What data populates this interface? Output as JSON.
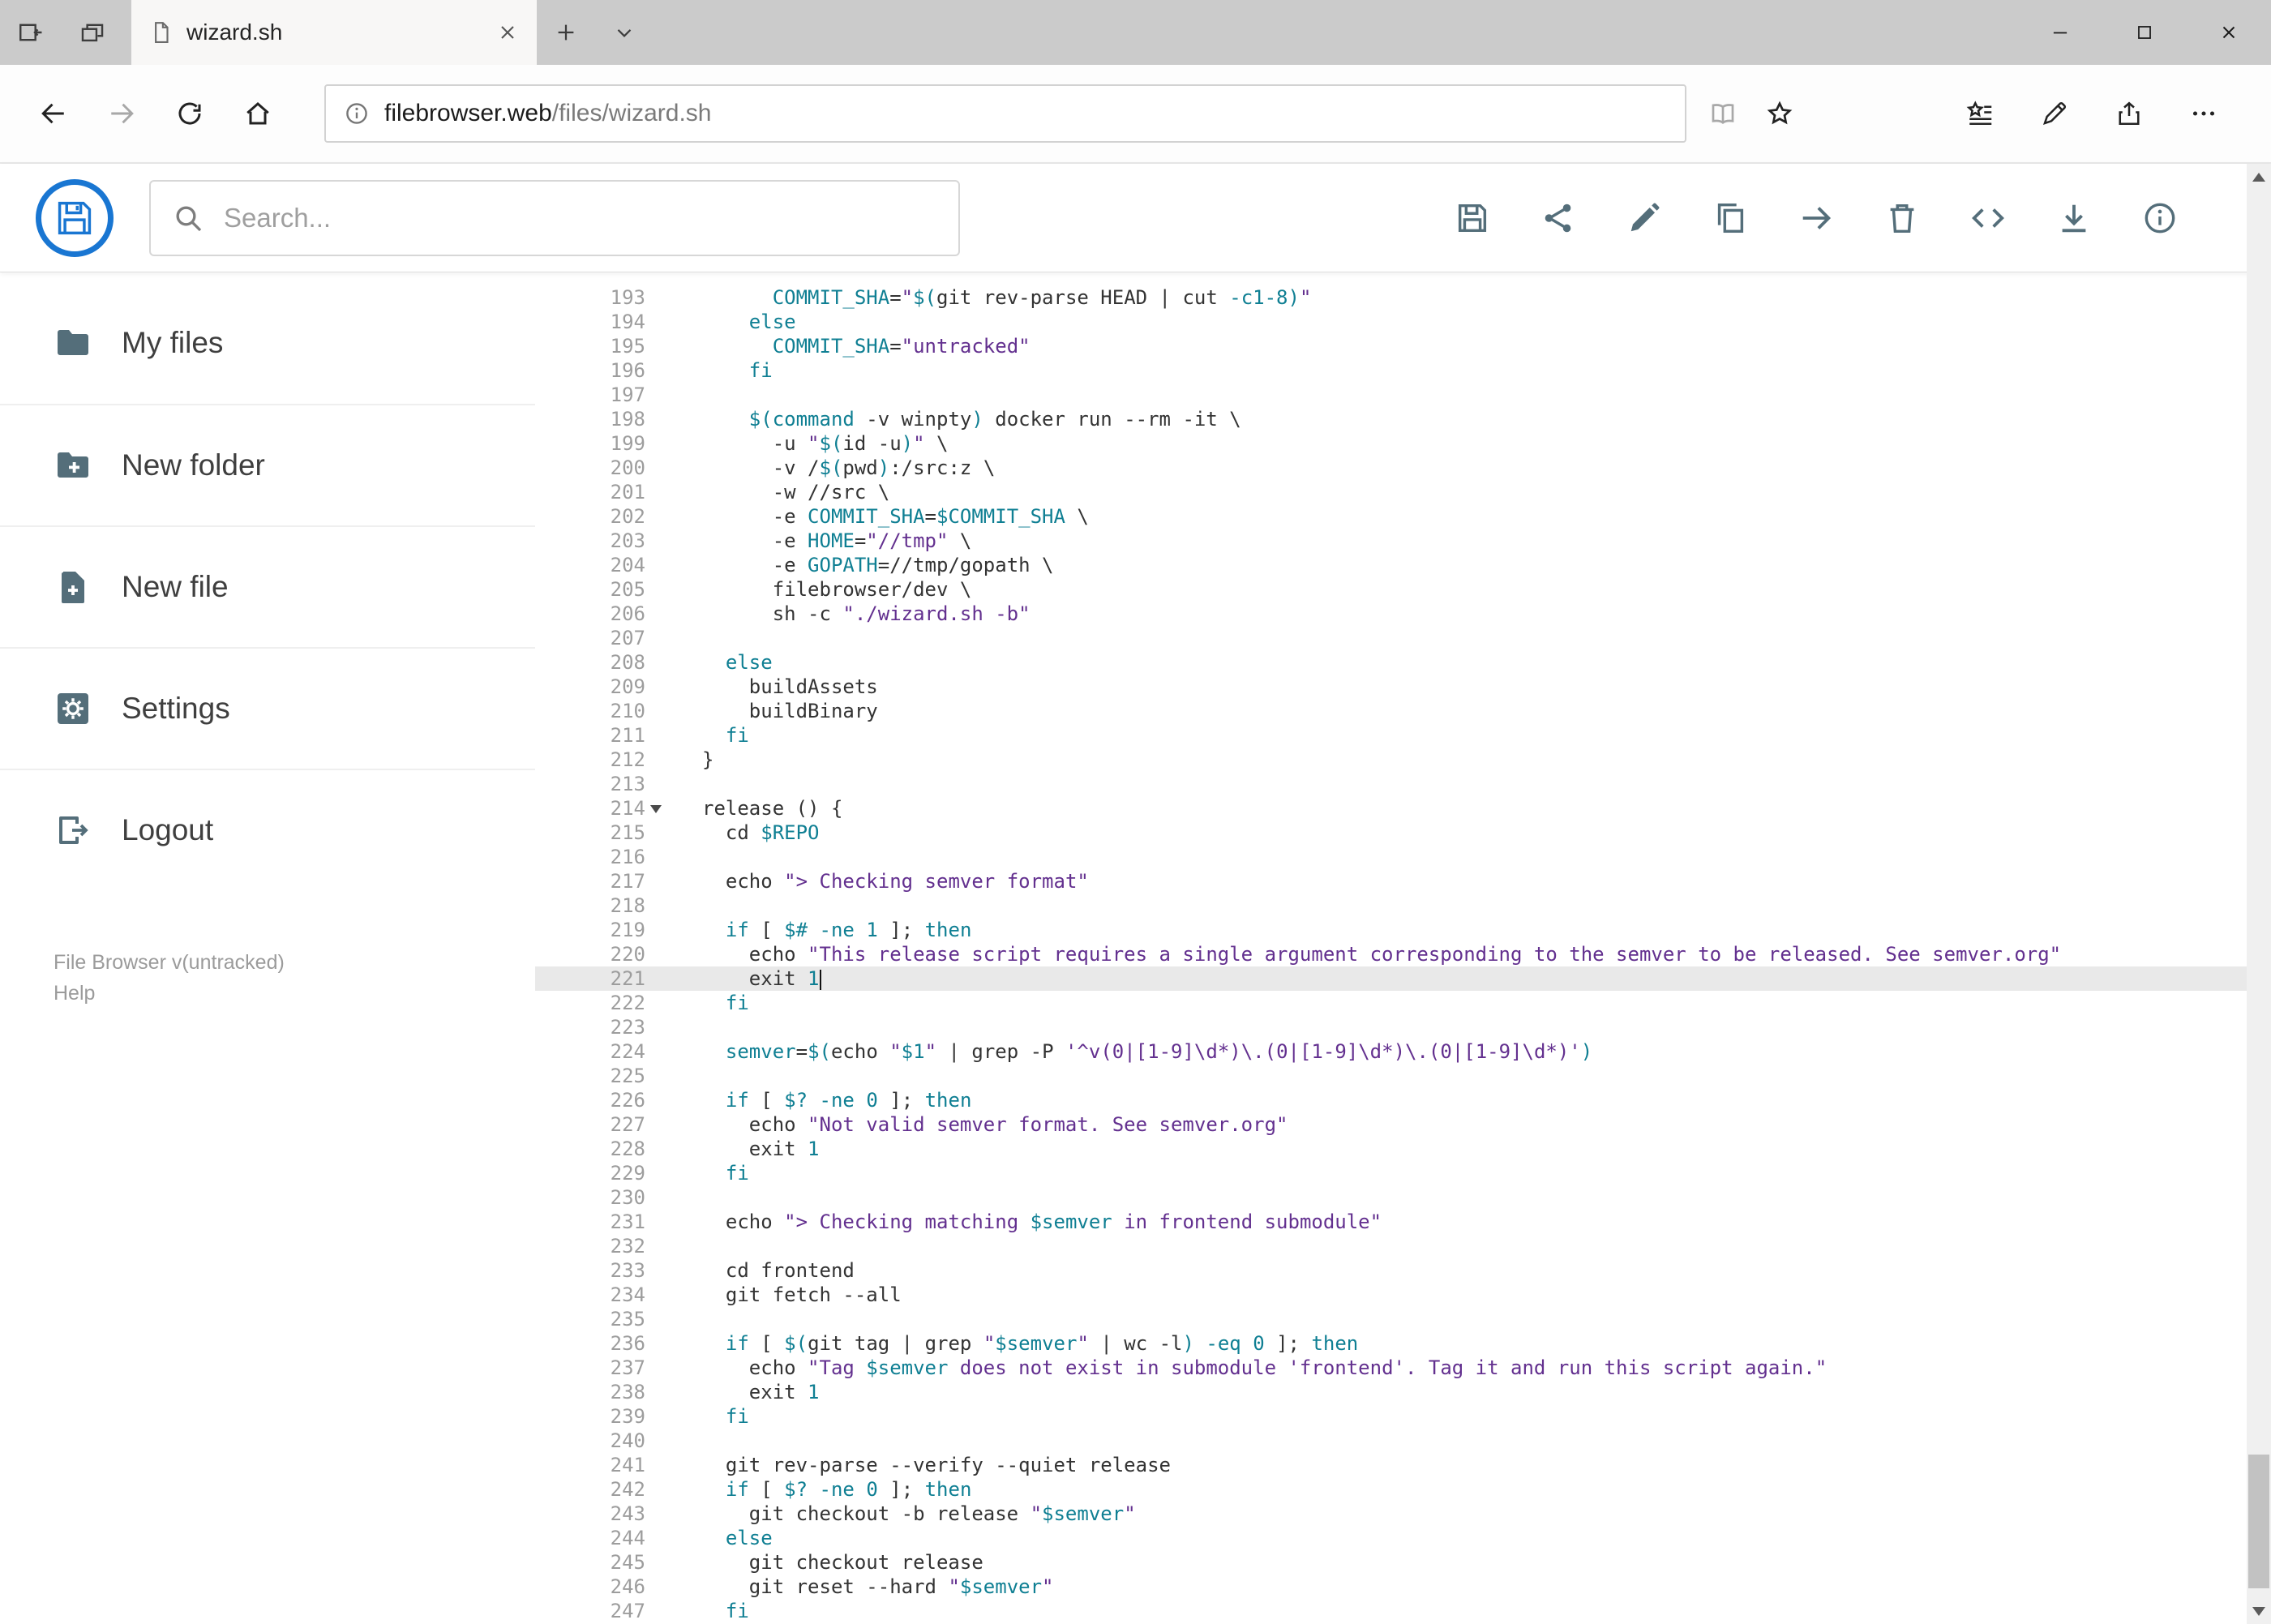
{
  "browser": {
    "tab_title": "wizard.sh",
    "url_host": "filebrowser.web",
    "url_path": "/files/wizard.sh"
  },
  "header": {
    "search_placeholder": "Search...",
    "toolbar": [
      {
        "name": "save-icon",
        "glyph": "save"
      },
      {
        "name": "share-icon",
        "glyph": "share-alt"
      },
      {
        "name": "edit-icon",
        "glyph": "edit"
      },
      {
        "name": "copy-icon",
        "glyph": "copy"
      },
      {
        "name": "move-icon",
        "glyph": "move"
      },
      {
        "name": "delete-icon",
        "glyph": "delete"
      },
      {
        "name": "code-icon",
        "glyph": "code"
      },
      {
        "name": "download-icon",
        "glyph": "download"
      },
      {
        "name": "info-icon",
        "glyph": "info"
      }
    ]
  },
  "sidebar": {
    "items": [
      {
        "id": "my-files",
        "icon": "folder-icon",
        "glyph": "folder",
        "label": "My files"
      },
      {
        "id": "new-folder",
        "icon": "folder-plus-icon",
        "glyph": "folder-plus",
        "label": "New folder"
      },
      {
        "id": "new-file",
        "icon": "file-plus-icon",
        "glyph": "file-plus",
        "label": "New file"
      },
      {
        "id": "settings",
        "icon": "gear-icon",
        "glyph": "gear",
        "label": "Settings"
      },
      {
        "id": "logout",
        "icon": "logout-icon",
        "glyph": "logout",
        "label": "Logout"
      }
    ],
    "footer": {
      "version": "File Browser v(untracked)",
      "help": "Help"
    }
  },
  "editor": {
    "colors": {
      "keyword": "#0f7f93",
      "string": "#63308f",
      "default": "#333333",
      "gutter": "#9d9d9d",
      "active_line_bg": "#e9e9e9"
    },
    "lines": [
      {
        "n": 193,
        "seg": [
          [
            "d",
            "      "
          ],
          [
            "v",
            "COMMIT_SHA"
          ],
          [
            "d",
            "="
          ],
          [
            "s",
            "\""
          ],
          [
            "v",
            "$("
          ],
          [
            "d",
            "git rev-parse HEAD | cut "
          ],
          [
            "k",
            "-c1-8"
          ],
          [
            "v",
            ")"
          ],
          [
            "s",
            "\""
          ]
        ]
      },
      {
        "n": 194,
        "seg": [
          [
            "d",
            "    "
          ],
          [
            "k",
            "else"
          ]
        ]
      },
      {
        "n": 195,
        "seg": [
          [
            "d",
            "      "
          ],
          [
            "v",
            "COMMIT_SHA"
          ],
          [
            "d",
            "="
          ],
          [
            "s",
            "\"untracked\""
          ]
        ]
      },
      {
        "n": 196,
        "seg": [
          [
            "d",
            "    "
          ],
          [
            "k",
            "fi"
          ]
        ]
      },
      {
        "n": 197,
        "seg": []
      },
      {
        "n": 198,
        "seg": [
          [
            "d",
            "    "
          ],
          [
            "v",
            "$("
          ],
          [
            "k",
            "command"
          ],
          [
            "d",
            " -v winpty"
          ],
          [
            "v",
            ")"
          ],
          [
            "d",
            " docker run --rm -it \\"
          ]
        ]
      },
      {
        "n": 199,
        "seg": [
          [
            "d",
            "      -u "
          ],
          [
            "s",
            "\""
          ],
          [
            "v",
            "$("
          ],
          [
            "d",
            "id -u"
          ],
          [
            "v",
            ")"
          ],
          [
            "s",
            "\""
          ],
          [
            "d",
            " \\"
          ]
        ]
      },
      {
        "n": 200,
        "seg": [
          [
            "d",
            "      -v /"
          ],
          [
            "v",
            "$("
          ],
          [
            "d",
            "pwd"
          ],
          [
            "v",
            ")"
          ],
          [
            "d",
            ":/src:z \\"
          ]
        ]
      },
      {
        "n": 201,
        "seg": [
          [
            "d",
            "      -w //src \\"
          ]
        ]
      },
      {
        "n": 202,
        "seg": [
          [
            "d",
            "      -e "
          ],
          [
            "v",
            "COMMIT_SHA"
          ],
          [
            "d",
            "="
          ],
          [
            "v",
            "$COMMIT_SHA"
          ],
          [
            "d",
            " \\"
          ]
        ]
      },
      {
        "n": 203,
        "seg": [
          [
            "d",
            "      -e "
          ],
          [
            "v",
            "HOME"
          ],
          [
            "d",
            "="
          ],
          [
            "s",
            "\"//tmp\""
          ],
          [
            "d",
            " \\"
          ]
        ]
      },
      {
        "n": 204,
        "seg": [
          [
            "d",
            "      -e "
          ],
          [
            "v",
            "GOPATH"
          ],
          [
            "d",
            "=//tmp/gopath \\"
          ]
        ]
      },
      {
        "n": 205,
        "seg": [
          [
            "d",
            "      filebrowser/dev \\"
          ]
        ]
      },
      {
        "n": 206,
        "seg": [
          [
            "d",
            "      sh -c "
          ],
          [
            "s",
            "\"./wizard.sh -b\""
          ]
        ]
      },
      {
        "n": 207,
        "seg": []
      },
      {
        "n": 208,
        "seg": [
          [
            "d",
            "  "
          ],
          [
            "k",
            "else"
          ]
        ]
      },
      {
        "n": 209,
        "seg": [
          [
            "d",
            "    buildAssets"
          ]
        ]
      },
      {
        "n": 210,
        "seg": [
          [
            "d",
            "    buildBinary"
          ]
        ]
      },
      {
        "n": 211,
        "seg": [
          [
            "d",
            "  "
          ],
          [
            "k",
            "fi"
          ]
        ]
      },
      {
        "n": 212,
        "seg": [
          [
            "d",
            "}"
          ]
        ]
      },
      {
        "n": 213,
        "seg": []
      },
      {
        "n": 214,
        "fold": true,
        "seg": [
          [
            "d",
            "release () {"
          ]
        ]
      },
      {
        "n": 215,
        "seg": [
          [
            "d",
            "  cd "
          ],
          [
            "v",
            "$REPO"
          ]
        ]
      },
      {
        "n": 216,
        "seg": []
      },
      {
        "n": 217,
        "seg": [
          [
            "d",
            "  echo "
          ],
          [
            "s",
            "\"> Checking semver format\""
          ]
        ]
      },
      {
        "n": 218,
        "seg": []
      },
      {
        "n": 219,
        "seg": [
          [
            "d",
            "  "
          ],
          [
            "k",
            "if"
          ],
          [
            "d",
            " [ "
          ],
          [
            "v",
            "$#"
          ],
          [
            "d",
            " "
          ],
          [
            "k",
            "-ne"
          ],
          [
            "d",
            " "
          ],
          [
            "n",
            "1"
          ],
          [
            "d",
            " ]; "
          ],
          [
            "k",
            "then"
          ]
        ]
      },
      {
        "n": 220,
        "seg": [
          [
            "d",
            "    echo "
          ],
          [
            "s",
            "\"This release script requires a single argument corresponding to the semver to be released. See semver.org\""
          ]
        ]
      },
      {
        "n": 221,
        "active": true,
        "cursor": true,
        "seg": [
          [
            "d",
            "    exit "
          ],
          [
            "n",
            "1"
          ]
        ]
      },
      {
        "n": 222,
        "seg": [
          [
            "d",
            "  "
          ],
          [
            "k",
            "fi"
          ]
        ]
      },
      {
        "n": 223,
        "seg": []
      },
      {
        "n": 224,
        "seg": [
          [
            "d",
            "  "
          ],
          [
            "v",
            "semver"
          ],
          [
            "d",
            "="
          ],
          [
            "v",
            "$("
          ],
          [
            "d",
            "echo "
          ],
          [
            "s",
            "\""
          ],
          [
            "v",
            "$1"
          ],
          [
            "s",
            "\""
          ],
          [
            "d",
            " | grep -P "
          ],
          [
            "s",
            "'^v(0|[1-9]\\d*)\\.(0|[1-9]\\d*)\\.(0|[1-9]\\d*)'"
          ],
          [
            "v",
            ")"
          ]
        ]
      },
      {
        "n": 225,
        "seg": []
      },
      {
        "n": 226,
        "seg": [
          [
            "d",
            "  "
          ],
          [
            "k",
            "if"
          ],
          [
            "d",
            " [ "
          ],
          [
            "v",
            "$?"
          ],
          [
            "d",
            " "
          ],
          [
            "k",
            "-ne"
          ],
          [
            "d",
            " "
          ],
          [
            "n",
            "0"
          ],
          [
            "d",
            " ]; "
          ],
          [
            "k",
            "then"
          ]
        ]
      },
      {
        "n": 227,
        "seg": [
          [
            "d",
            "    echo "
          ],
          [
            "s",
            "\"Not valid semver format. See semver.org\""
          ]
        ]
      },
      {
        "n": 228,
        "seg": [
          [
            "d",
            "    exit "
          ],
          [
            "n",
            "1"
          ]
        ]
      },
      {
        "n": 229,
        "seg": [
          [
            "d",
            "  "
          ],
          [
            "k",
            "fi"
          ]
        ]
      },
      {
        "n": 230,
        "seg": []
      },
      {
        "n": 231,
        "seg": [
          [
            "d",
            "  echo "
          ],
          [
            "s",
            "\"> Checking matching "
          ],
          [
            "v",
            "$semver"
          ],
          [
            "s",
            " in frontend submodule\""
          ]
        ]
      },
      {
        "n": 232,
        "seg": []
      },
      {
        "n": 233,
        "seg": [
          [
            "d",
            "  cd frontend"
          ]
        ]
      },
      {
        "n": 234,
        "seg": [
          [
            "d",
            "  git fetch --all"
          ]
        ]
      },
      {
        "n": 235,
        "seg": []
      },
      {
        "n": 236,
        "seg": [
          [
            "d",
            "  "
          ],
          [
            "k",
            "if"
          ],
          [
            "d",
            " [ "
          ],
          [
            "v",
            "$("
          ],
          [
            "d",
            "git tag | grep "
          ],
          [
            "s",
            "\""
          ],
          [
            "v",
            "$semver"
          ],
          [
            "s",
            "\""
          ],
          [
            "d",
            " | wc -l"
          ],
          [
            "v",
            ")"
          ],
          [
            "d",
            " "
          ],
          [
            "k",
            "-eq"
          ],
          [
            "d",
            " "
          ],
          [
            "n",
            "0"
          ],
          [
            "d",
            " ]; "
          ],
          [
            "k",
            "then"
          ]
        ]
      },
      {
        "n": 237,
        "seg": [
          [
            "d",
            "    echo "
          ],
          [
            "s",
            "\"Tag "
          ],
          [
            "v",
            "$semver"
          ],
          [
            "s",
            " does not exist in submodule 'frontend'. Tag it and run this script again.\""
          ]
        ]
      },
      {
        "n": 238,
        "seg": [
          [
            "d",
            "    exit "
          ],
          [
            "n",
            "1"
          ]
        ]
      },
      {
        "n": 239,
        "seg": [
          [
            "d",
            "  "
          ],
          [
            "k",
            "fi"
          ]
        ]
      },
      {
        "n": 240,
        "seg": []
      },
      {
        "n": 241,
        "seg": [
          [
            "d",
            "  git rev-parse --verify --quiet release"
          ]
        ]
      },
      {
        "n": 242,
        "seg": [
          [
            "d",
            "  "
          ],
          [
            "k",
            "if"
          ],
          [
            "d",
            " [ "
          ],
          [
            "v",
            "$?"
          ],
          [
            "d",
            " "
          ],
          [
            "k",
            "-ne"
          ],
          [
            "d",
            " "
          ],
          [
            "n",
            "0"
          ],
          [
            "d",
            " ]; "
          ],
          [
            "k",
            "then"
          ]
        ]
      },
      {
        "n": 243,
        "seg": [
          [
            "d",
            "    git checkout -b release "
          ],
          [
            "s",
            "\""
          ],
          [
            "v",
            "$semver"
          ],
          [
            "s",
            "\""
          ]
        ]
      },
      {
        "n": 244,
        "seg": [
          [
            "d",
            "  "
          ],
          [
            "k",
            "else"
          ]
        ]
      },
      {
        "n": 245,
        "seg": [
          [
            "d",
            "    git checkout release"
          ]
        ]
      },
      {
        "n": 246,
        "seg": [
          [
            "d",
            "    git reset --hard "
          ],
          [
            "s",
            "\""
          ],
          [
            "v",
            "$semver"
          ],
          [
            "s",
            "\""
          ]
        ]
      },
      {
        "n": 247,
        "seg": [
          [
            "d",
            "  "
          ],
          [
            "k",
            "fi"
          ]
        ]
      }
    ]
  }
}
